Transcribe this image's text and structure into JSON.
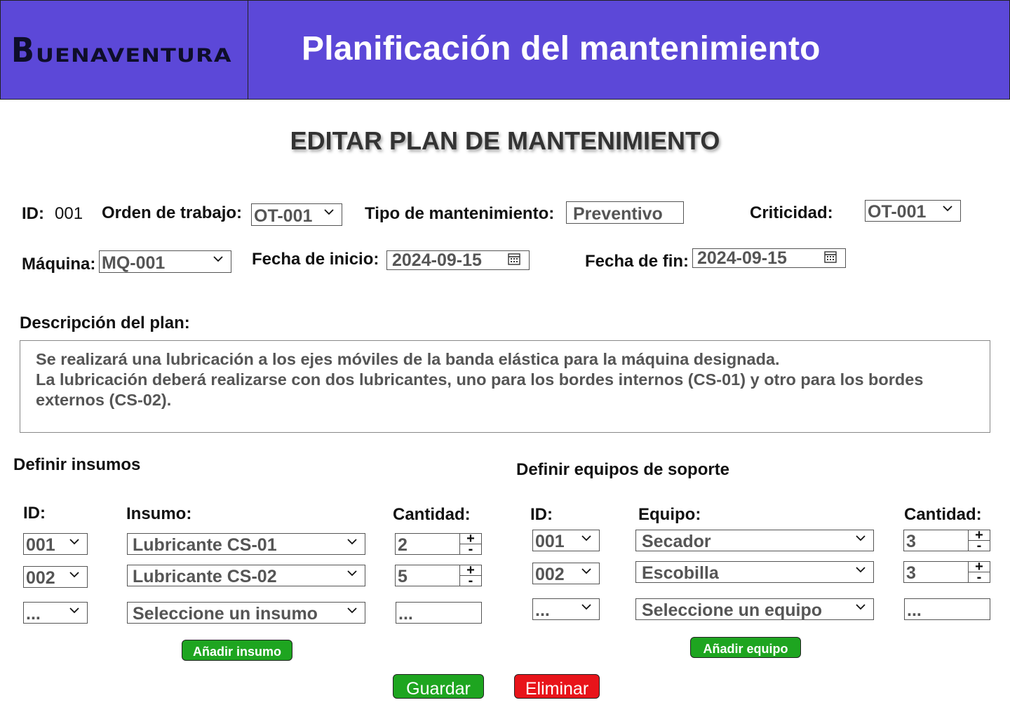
{
  "header": {
    "logo_initial": "B",
    "logo_rest": "UENAVENTURA",
    "title": "Planificación del mantenimiento",
    "bg_color": "#5c48d8"
  },
  "page_title": "EDITAR PLAN DE MANTENIMIENTO",
  "form": {
    "id_label": "ID:",
    "id_value": "001",
    "work_order_label": "Orden de trabajo:",
    "work_order_value": "OT-001",
    "maintenance_type_label": "Tipo de mantenimiento:",
    "maintenance_type_value": "Preventivo",
    "criticality_label": "Criticidad:",
    "criticality_value": "OT-001",
    "machine_label": "Máquina:",
    "machine_value": "MQ-001",
    "start_date_label": "Fecha de inicio:",
    "start_date_value": "2024-09-15",
    "end_date_label": "Fecha de fin:",
    "end_date_value": "2024-09-15",
    "description_label": "Descripción del plan:",
    "description_lines": [
      "Se realizará una lubricación a los ejes móviles de la banda elástica para la máquina designada.",
      "La lubricación deberá realizarse con dos lubricantes, uno para los bordes internos (CS-01) y otro para los bordes",
      "externos (CS-02)."
    ]
  },
  "supplies": {
    "section_title": "Definir insumos",
    "col_id": "ID:",
    "col_item": "Insumo:",
    "col_qty": "Cantidad:",
    "rows": [
      {
        "id": "001",
        "item": "Lubricante CS-01",
        "qty": "2"
      },
      {
        "id": "002",
        "item": "Lubricante CS-02",
        "qty": "5"
      }
    ],
    "new_row": {
      "id": "...",
      "item": "Seleccione un insumo",
      "qty": "..."
    },
    "add_button": "Añadir insumo"
  },
  "equipment": {
    "section_title": "Definir equipos de soporte",
    "col_id": "ID:",
    "col_item": "Equipo:",
    "col_qty": "Cantidad:",
    "rows": [
      {
        "id": "001",
        "item": "Secador",
        "qty": "3"
      },
      {
        "id": "002",
        "item": "Escobilla",
        "qty": "3"
      }
    ],
    "new_row": {
      "id": "...",
      "item": "Seleccione un equipo",
      "qty": "..."
    },
    "add_button": "Añadir equipo"
  },
  "stepper": {
    "plus": "+",
    "minus": "-"
  },
  "actions": {
    "save": "Guardar",
    "delete": "Eliminar",
    "save_color": "#1ea520",
    "delete_color": "#e8141a"
  },
  "icons": {
    "dropdown": "chevron-down-icon",
    "date": "calendar-icon"
  }
}
